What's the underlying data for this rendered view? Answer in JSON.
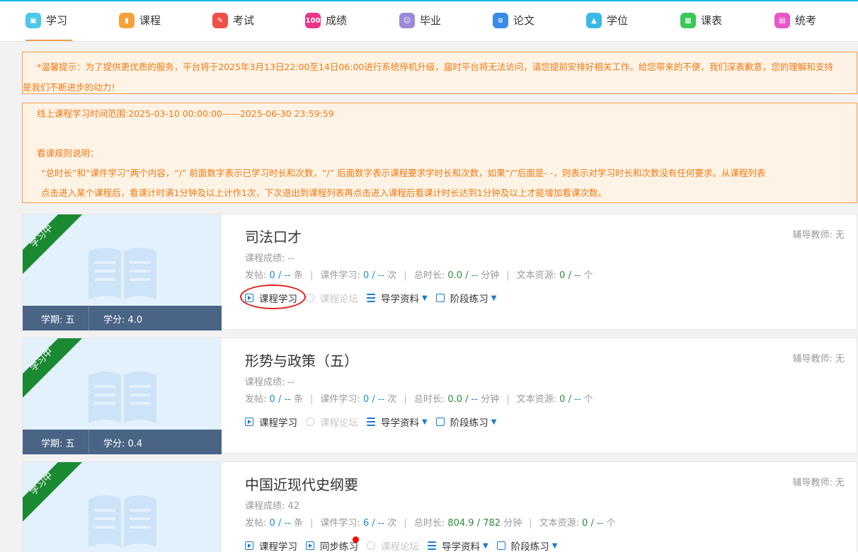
{
  "nav": {
    "items": [
      {
        "label": "学习",
        "icon": "study-icon",
        "color": "#4ec8e8",
        "active": true
      },
      {
        "label": "课程",
        "icon": "course-icon",
        "color": "#f7a13a"
      },
      {
        "label": "考试",
        "icon": "exam-icon",
        "color": "#f0504a"
      },
      {
        "label": "成绩",
        "icon": "grade-icon",
        "color": "#e8368a"
      },
      {
        "label": "毕业",
        "icon": "graduation-icon",
        "color": "#9a8ad8"
      },
      {
        "label": "论文",
        "icon": "thesis-icon",
        "color": "#3a8ae8"
      },
      {
        "label": "学位",
        "icon": "degree-icon",
        "color": "#3ab8e8"
      },
      {
        "label": "课表",
        "icon": "schedule-icon",
        "color": "#3ac858"
      },
      {
        "label": "统考",
        "icon": "unified-exam-icon",
        "color": "#e858c8"
      }
    ]
  },
  "notice1": {
    "line1": "*温馨提示：为了提供更优质的服务，平台将于2025年3月13日22:00至14日06:00进行系统停机升级，届时平台将无法访问，请您提前安排好相关工作。给您带来的不便，我们深表歉意，您的理解和支持",
    "line2": "是我们不断进步的动力！"
  },
  "notice2": {
    "time_range": "线上课程学习时间范围:2025-03-10 00:00:00——2025-06-30 23:59:59",
    "rules_title": "看课规则说明：",
    "rules_line1": "“总时长”和“课件学习”两个内容，“/” 前面数字表示已学习时长和次数，“/” 后面数字表示课程要求学时长和次数，如果“/”后面是- -，则表示对学习时长和次数没有任何要求。从课程列表",
    "rules_line2": "点击进入某个课程后，看课计时满1分钟及以上计作1次，下次退出到课程列表再点击进入课程后看课计时长达到1分钟及以上才能增加看课次数。"
  },
  "labels": {
    "status": "学习中",
    "teacher": "辅导教师: 无",
    "score_prefix": "课程成绩: ",
    "posts": "发帖:",
    "posts_unit": "条",
    "courseware": "课件学习:",
    "courseware_unit": "次",
    "total_time": "总时长:",
    "total_time_unit": "分钟",
    "text_res": "文本资源:",
    "text_res_unit": "个",
    "study": "课程学习",
    "sync_practice": "同步练习",
    "forum": "课程论坛",
    "guide": "导学资料",
    "stage": "阶段练习"
  },
  "courses": [
    {
      "title": "司法口才",
      "term": "学期: 五",
      "credit": "学分: 4.0",
      "score": "--",
      "posts_done": "0",
      "posts_req": "--",
      "cw_done": "0",
      "cw_req": "--",
      "time_done": "0.0",
      "time_req": "--",
      "res_done": "0",
      "res_req": "--"
    },
    {
      "title": "形势与政策（五）",
      "term": "学期: 五",
      "credit": "学分: 0.4",
      "score": "--",
      "posts_done": "0",
      "posts_req": "--",
      "cw_done": "0",
      "cw_req": "--",
      "time_done": "0.0",
      "time_req": "--",
      "res_done": "0",
      "res_req": "--"
    },
    {
      "title": "中国近现代史纲要",
      "term": "",
      "credit": "",
      "score": "42",
      "posts_done": "0",
      "posts_req": "--",
      "cw_done": "6",
      "cw_req": "--",
      "time_done": "804.9",
      "time_req": "782",
      "res_done": "0",
      "res_req": "--"
    }
  ]
}
